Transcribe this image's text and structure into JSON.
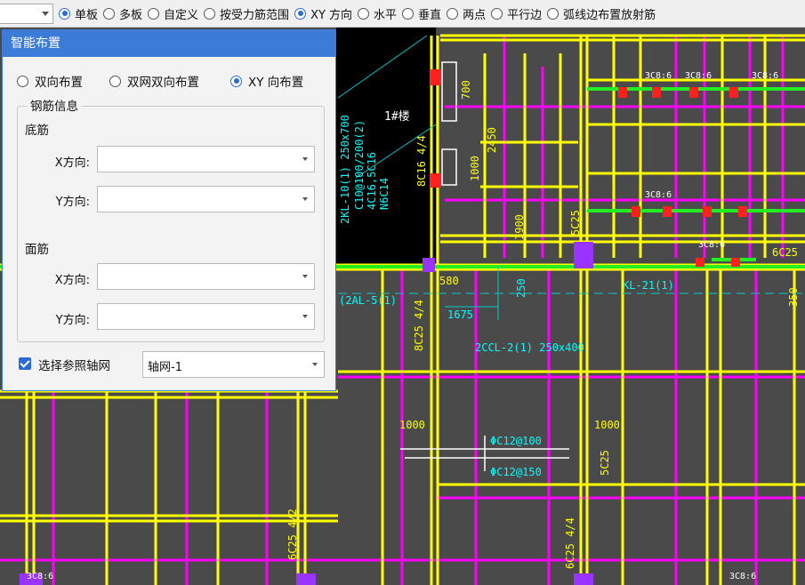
{
  "toolbar": {
    "combo_value": "",
    "options": [
      {
        "label": "单板",
        "selected": true
      },
      {
        "label": "多板",
        "selected": false
      },
      {
        "label": "自定义",
        "selected": false
      },
      {
        "label": "按受力筋范围",
        "selected": false
      },
      {
        "label": "XY 方向",
        "selected": true
      },
      {
        "label": "水平",
        "selected": false
      },
      {
        "label": "垂直",
        "selected": false
      },
      {
        "label": "两点",
        "selected": false
      },
      {
        "label": "平行边",
        "selected": false
      },
      {
        "label": "弧线边布置放射筋",
        "selected": false
      }
    ]
  },
  "dialog": {
    "title": "智能布置",
    "modes": [
      {
        "label": "双向布置",
        "selected": false
      },
      {
        "label": "双网双向布置",
        "selected": false
      },
      {
        "label": "XY 向布置",
        "selected": true
      }
    ],
    "group_title": "钢筋信息",
    "bottom_label": "底筋",
    "top_label": "面筋",
    "x_label": "X方向:",
    "y_label": "Y方向:",
    "bottom_x_value": "",
    "bottom_y_value": "",
    "top_x_value": "",
    "top_y_value": "",
    "ref_checkbox_label": "选择参照轴网",
    "ref_checked": true,
    "ref_axis_value": "轴网-1"
  },
  "cad": {
    "colors": {
      "background": "#4a4a4a",
      "beam": "#ffff00",
      "bar": "#ff00ff",
      "dim": "#00cccc",
      "wall": "#000000"
    },
    "labels": [
      "2KL-10(1) 250x700",
      "C10@100/200(2)",
      "4C16,5C16",
      "N6C14",
      "1#楼",
      "8C16 4/4",
      "700",
      "2450",
      "1000",
      "1900",
      "1675",
      "250",
      "580",
      "1000",
      "1000",
      "ΦC12@100",
      "ΦC12@150",
      "5C25",
      "8C25 4/4",
      "6C25 4/2",
      "6C25 4/4",
      "3C8:6",
      "5C25",
      "3C8:6",
      "3C8:6",
      "3C8:6",
      "3C8:6",
      "3C8:6",
      "3C8:6",
      "(2AL-5(1)",
      "350",
      "KL-21(1)",
      "2CCL-2(1) 250x400",
      "6C25"
    ]
  }
}
